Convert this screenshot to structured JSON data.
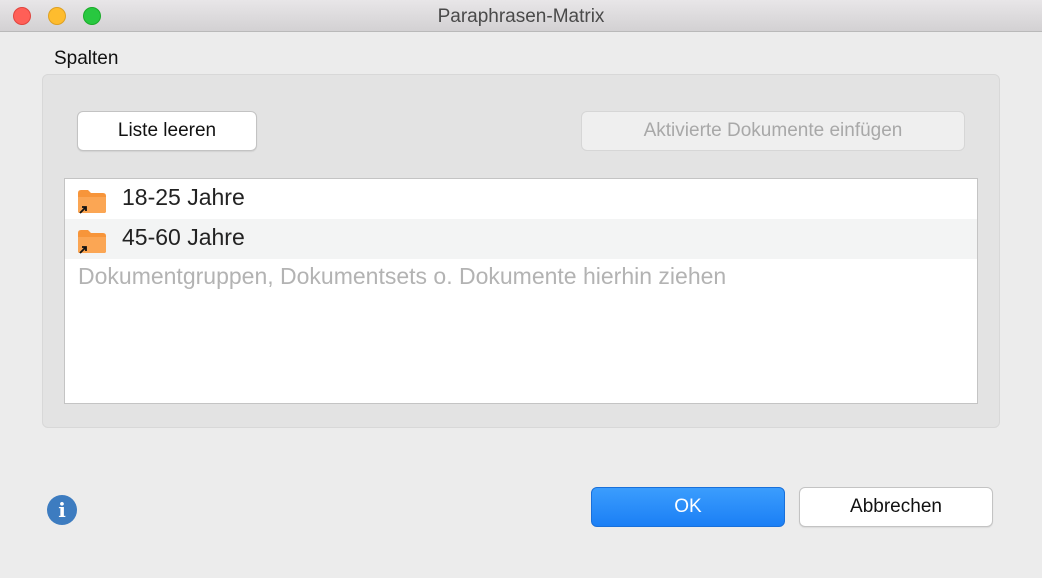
{
  "window": {
    "title": "Paraphrasen-Matrix"
  },
  "columns_section": {
    "label": "Spalten",
    "clear_list_button": "Liste leeren",
    "insert_activated_button": "Aktivierte Dokumente einfügen",
    "items": [
      {
        "label": "18-25 Jahre",
        "icon": "folder-link-icon"
      },
      {
        "label": "45-60 Jahre",
        "icon": "folder-link-icon"
      }
    ],
    "drop_placeholder": "Dokumentgruppen, Dokumentsets o. Dokumente hierhin ziehen"
  },
  "footer": {
    "info_icon": "info-icon",
    "ok_button": "OK",
    "cancel_button": "Abbrechen"
  },
  "colors": {
    "primary_button": "#1b7ff5",
    "folder": "#f7953a",
    "info": "#3d7cc0"
  }
}
